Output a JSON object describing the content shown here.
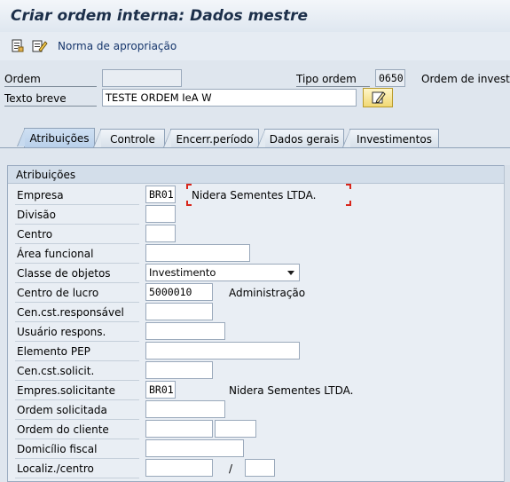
{
  "window": {
    "title": "Criar ordem interna: Dados mestre"
  },
  "toolbar": {
    "text": "Norma de apropriação"
  },
  "header": {
    "ordem_label": "Ordem",
    "ordem_value": "",
    "tipo_ordem_label": "Tipo ordem",
    "tipo_ordem_value": "0650",
    "tipo_ordem_desc": "Ordem de investi...",
    "texto_breve_label": "Texto breve",
    "texto_breve_value": "TESTE ORDEM IeA W"
  },
  "tabs": [
    "Atribuições",
    "Controle",
    "Encerr.período",
    "Dados gerais",
    "Investimentos"
  ],
  "group": {
    "title": "Atribuições",
    "empresa_label": "Empresa",
    "empresa_value": "BR01",
    "empresa_desc": "Nidera Sementes LTDA.",
    "divisao_label": "Divisão",
    "centro_label": "Centro",
    "area_funcional_label": "Área funcional",
    "classe_objetos_label": "Classe de objetos",
    "classe_objetos_value": "Investimento",
    "centro_lucro_label": "Centro de lucro",
    "centro_lucro_value": "5000010",
    "centro_lucro_desc": "Administração",
    "cen_cst_resp_label": "Cen.cst.responsável",
    "usuario_resp_label": "Usuário respons.",
    "elemento_pep_label": "Elemento PEP",
    "cen_cst_solicit_label": "Cen.cst.solicit.",
    "empres_solicitante_label": "Empres.solicitante",
    "empres_solicitante_value": "BR01",
    "empres_solicitante_desc": "Nidera Sementes LTDA.",
    "ordem_solicitada_label": "Ordem solicitada",
    "ordem_cliente_label": "Ordem do cliente",
    "domicilio_fiscal_label": "Domicílio fiscal",
    "localiz_centro_label": "Localiz./centro",
    "localiz_sep": "/"
  },
  "colors": {
    "title": "#1c2f4a",
    "toolbar_text": "#15356b",
    "focus": "#d8261b"
  },
  "icons": [
    "document-save-icon",
    "edit-document-icon",
    "long-text-edit-icon",
    "dropdown-arrow-icon"
  ]
}
